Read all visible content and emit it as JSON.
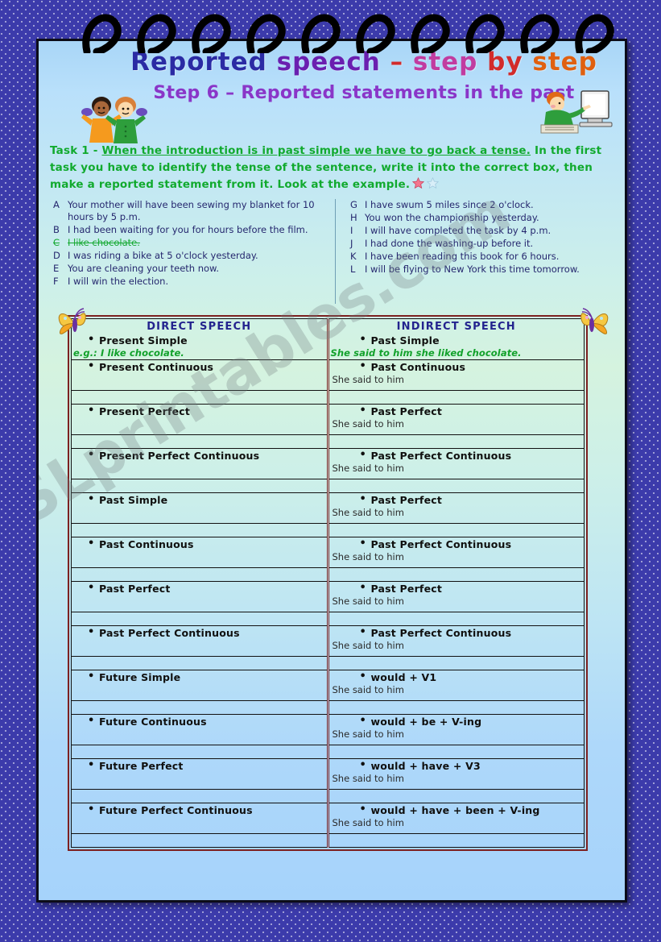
{
  "title": {
    "main_words": [
      "Reported",
      "speech",
      "–",
      "step",
      "by",
      "step"
    ],
    "main_full": "Reported speech – step by step",
    "step": "Step 6 – Reported statements in the past"
  },
  "instructions": {
    "task_label": "Task 1 -",
    "underlined": "When the introduction is in past simple we have to go back a tense.",
    "rest": "In the first task you have to identify the tense of the sentence, write it into the correct box, then make a reported statement from it. Look at the example."
  },
  "sentences": {
    "left": [
      {
        "letter": "A",
        "text": "Your mother will have been sewing my blanket for 10 hours by 5 p.m.",
        "struck": false
      },
      {
        "letter": "B",
        "text": "I had been waiting for you for hours before the film.",
        "struck": false
      },
      {
        "letter": "C",
        "text": "I like chocolate.",
        "struck": true
      },
      {
        "letter": "D",
        "text": "I was riding a bike at 5 o'clock yesterday.",
        "struck": false
      },
      {
        "letter": "E",
        "text": "You are cleaning your teeth now.",
        "struck": false
      },
      {
        "letter": "F",
        "text": "I will win the election.",
        "struck": false
      }
    ],
    "right": [
      {
        "letter": "G",
        "text": "I have swum 5 miles since 2 o'clock.",
        "struck": false
      },
      {
        "letter": "H",
        "text": "You won the championship yesterday.",
        "struck": false
      },
      {
        "letter": "I",
        "text": "I will have completed the task by 4 p.m.",
        "struck": false
      },
      {
        "letter": "J",
        "text": "I had done the washing-up before it.",
        "struck": false
      },
      {
        "letter": "K",
        "text": "I have been reading this book for 6 hours.",
        "struck": false
      },
      {
        "letter": "L",
        "text": "I will be flying to New York this time tomorrow.",
        "struck": false
      }
    ]
  },
  "table": {
    "headers": {
      "left": "DIRECT SPEECH",
      "right": "INDIRECT SPEECH"
    },
    "example": {
      "left_tense": "Present Simple",
      "left_example": "e.g.: I like chocolate.",
      "right_tense": "Past Simple",
      "right_example": "She said to him she liked chocolate."
    },
    "stub": "She said to him",
    "rows": [
      {
        "left": "Present Continuous",
        "right": "Past Continuous"
      },
      {
        "left": "Present Perfect",
        "right": "Past Perfect"
      },
      {
        "left": "Present Perfect Continuous",
        "right": "Past Perfect Continuous"
      },
      {
        "left": "Past Simple",
        "right": "Past Perfect"
      },
      {
        "left": "Past Continuous",
        "right": "Past Perfect Continuous"
      },
      {
        "left": "Past Perfect",
        "right": "Past Perfect"
      },
      {
        "left": "Past Perfect Continuous",
        "right": "Past Perfect Continuous"
      },
      {
        "left": "Future Simple",
        "right": "would + V1"
      },
      {
        "left": "Future Continuous",
        "right": "would + be + V-ing"
      },
      {
        "left": "Future Perfect",
        "right": "would + have + V3"
      },
      {
        "left": "Future Perfect Continuous",
        "right": "would + have + been + V-ing"
      }
    ]
  },
  "watermark": {
    "text": "ESLprintables.com"
  },
  "colors": {
    "background": "#3c3bab",
    "sheet_top": "#a9d6f7",
    "sheet_mid": "#d5f3df",
    "title_blue": "#2b2ba4",
    "title_purple": "#6a1fb0",
    "title_red": "#d22b2b",
    "step_purple": "#8a36c8",
    "instruction_green": "#11aa2e",
    "header_navy": "#23238e",
    "table_border": "#7d2020",
    "example_green": "#12a12b"
  }
}
